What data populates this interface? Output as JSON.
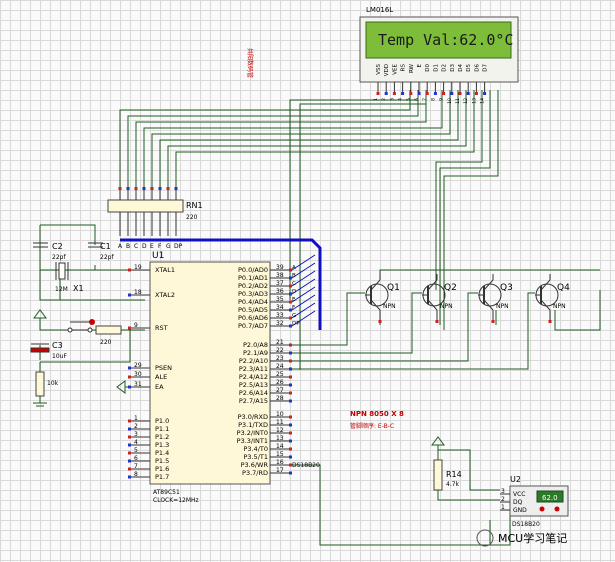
{
  "lcd": {
    "part": "LM016L",
    "display": "Temp Val:62.0°C",
    "pins": [
      "VSS",
      "VDD",
      "VEE",
      "RS",
      "RW",
      "E",
      "D0",
      "D1",
      "D2",
      "D3",
      "D4",
      "D5",
      "D6",
      "D7"
    ],
    "pin_numbers": [
      "1",
      "2",
      "3",
      "4",
      "5",
      "6",
      "7",
      "8",
      "9",
      "10",
      "11",
      "12",
      "13",
      "14"
    ]
  },
  "note_vertical": "共阳数码管",
  "rn1": {
    "ref": "RN1",
    "value": "220",
    "pins": [
      "A",
      "B",
      "C",
      "D",
      "E",
      "F",
      "G",
      "DP"
    ]
  },
  "c1": {
    "ref": "C1",
    "value": "22pf"
  },
  "c2": {
    "ref": "C2",
    "value": "22pf"
  },
  "c3": {
    "ref": "C3",
    "value": "10uF"
  },
  "x1": {
    "ref": "X1",
    "value": "12M"
  },
  "r_reset": {
    "value": "220"
  },
  "r_10k": {
    "value": "10k"
  },
  "u1": {
    "ref": "U1",
    "part": "AT89C51",
    "clock": "CLOCK=12MHz",
    "left_pins": [
      {
        "num": "19",
        "name": "XTAL1"
      },
      {
        "num": "18",
        "name": "XTAL2"
      },
      {
        "num": "9",
        "name": "RST"
      },
      {
        "num": "29",
        "name": "PSEN"
      },
      {
        "num": "30",
        "name": "ALE"
      },
      {
        "num": "31",
        "name": "EA"
      },
      {
        "num": "1",
        "name": "P1.0"
      },
      {
        "num": "2",
        "name": "P1.1"
      },
      {
        "num": "3",
        "name": "P1.2"
      },
      {
        "num": "4",
        "name": "P1.3"
      },
      {
        "num": "5",
        "name": "P1.4"
      },
      {
        "num": "6",
        "name": "P1.5"
      },
      {
        "num": "7",
        "name": "P1.6"
      },
      {
        "num": "8",
        "name": "P1.7"
      }
    ],
    "right_pins": [
      {
        "num": "39",
        "name": "P0.0/AD0"
      },
      {
        "num": "38",
        "name": "P0.1/AD1"
      },
      {
        "num": "37",
        "name": "P0.2/AD2"
      },
      {
        "num": "36",
        "name": "P0.3/AD3"
      },
      {
        "num": "35",
        "name": "P0.4/AD4"
      },
      {
        "num": "34",
        "name": "P0.5/AD5"
      },
      {
        "num": "33",
        "name": "P0.6/AD6"
      },
      {
        "num": "32",
        "name": "P0.7/AD7"
      },
      {
        "num": "21",
        "name": "P2.0/A8"
      },
      {
        "num": "22",
        "name": "P2.1/A9"
      },
      {
        "num": "23",
        "name": "P2.2/A10"
      },
      {
        "num": "24",
        "name": "P2.3/A11"
      },
      {
        "num": "25",
        "name": "P2.4/A12"
      },
      {
        "num": "26",
        "name": "P2.5/A13"
      },
      {
        "num": "27",
        "name": "P2.6/A14"
      },
      {
        "num": "28",
        "name": "P2.7/A15"
      },
      {
        "num": "10",
        "name": "P3.0/RXD"
      },
      {
        "num": "11",
        "name": "P3.1/TXD"
      },
      {
        "num": "12",
        "name": "P3.2/INT0"
      },
      {
        "num": "13",
        "name": "P3.3/INT1"
      },
      {
        "num": "14",
        "name": "P3.4/T0"
      },
      {
        "num": "15",
        "name": "P3.5/T1"
      },
      {
        "num": "16",
        "name": "P3.6/WR"
      },
      {
        "num": "17",
        "name": "P3.7/RD"
      }
    ],
    "bus_labels": [
      "A",
      "B",
      "C",
      "D",
      "E",
      "F",
      "G",
      "DP"
    ]
  },
  "transistors": [
    {
      "ref": "Q1",
      "type": "NPN"
    },
    {
      "ref": "Q2",
      "type": "NPN"
    },
    {
      "ref": "Q3",
      "type": "NPN"
    },
    {
      "ref": "Q4",
      "type": "NPN"
    }
  ],
  "npn_note": "NPN 8050 X 8",
  "npn_order": "管脚顺序: E-B-C",
  "ds_label": "DS18B20",
  "r14": {
    "ref": "R14",
    "value": "4.7k"
  },
  "u2": {
    "ref": "U2",
    "part": "DS18B20",
    "pins": [
      "VCC",
      "DQ",
      "GND"
    ],
    "pin_numbers": [
      "3",
      "2",
      "1"
    ],
    "reading": "62.0"
  },
  "watermark": "MCU学习笔记"
}
